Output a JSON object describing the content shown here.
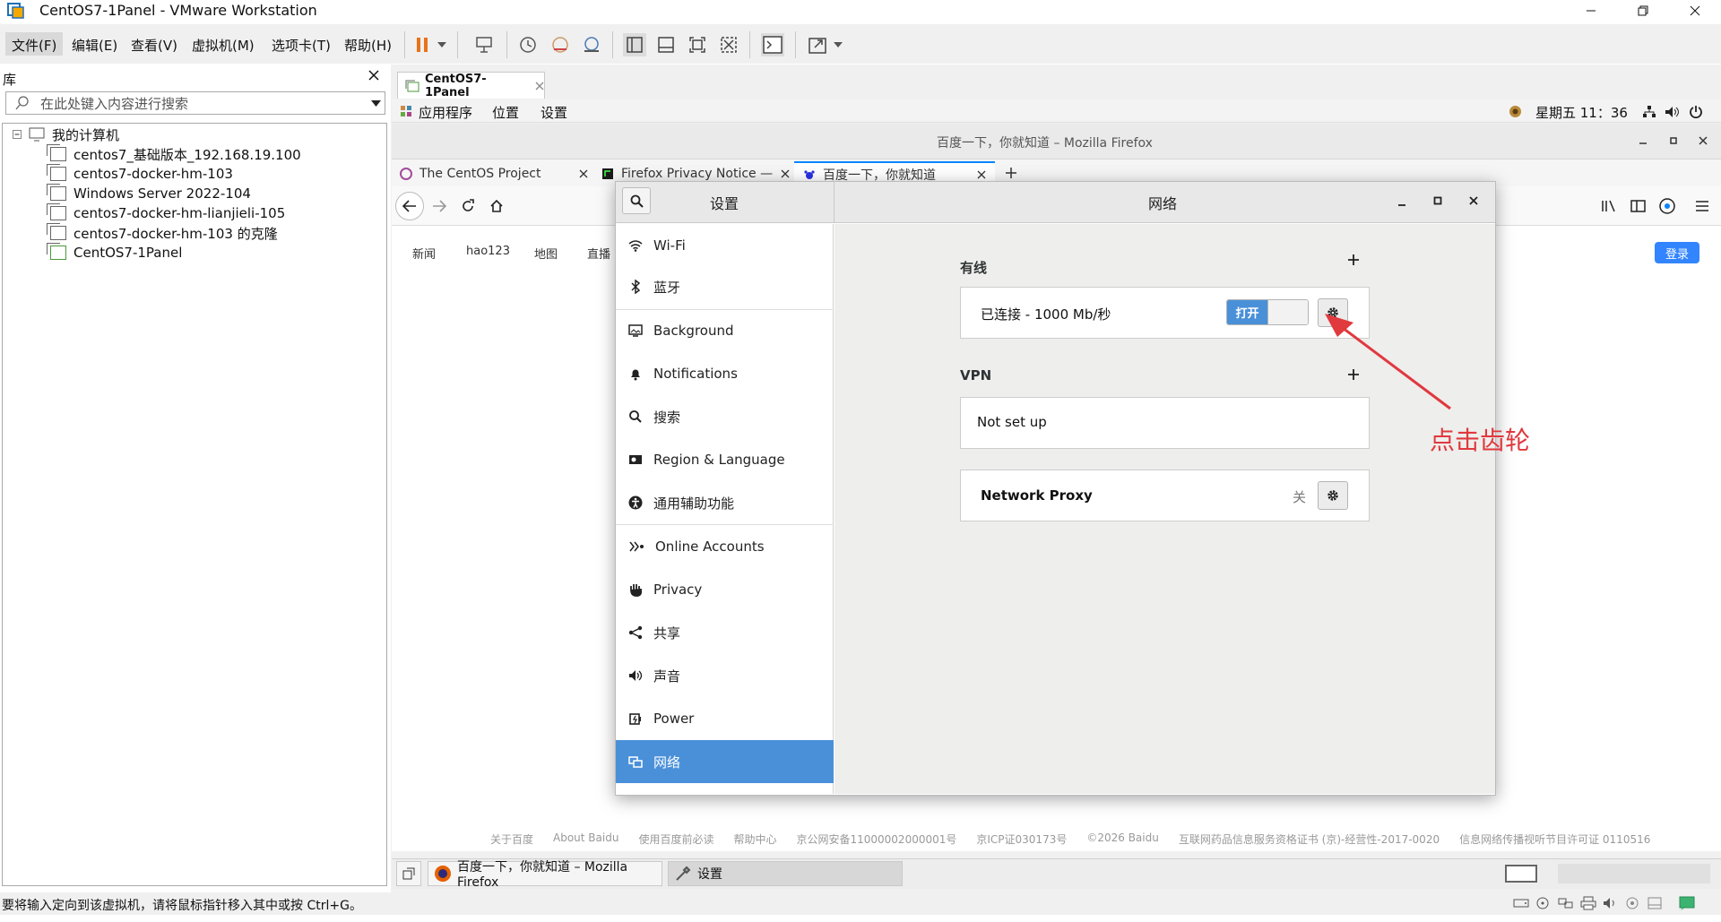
{
  "vm_window": {
    "title": "CentOS7-1Panel - VMware Workstation",
    "menus": [
      "文件(F)",
      "编辑(E)",
      "查看(V)",
      "虚拟机(M)",
      "选项卡(T)",
      "帮助(H)"
    ]
  },
  "library": {
    "title": "库",
    "search_placeholder": "在此处键入内容进行搜索",
    "root": "我的计算机",
    "items": [
      "centos7_基础版本_192.168.19.100",
      "centos7-docker-hm-103",
      "Windows Server 2022-104",
      "centos7-docker-hm-lianjieli-105",
      "centos7-docker-hm-103 的克隆",
      "CentOS7-1Panel"
    ]
  },
  "vm_tab": {
    "label": "CentOS7-1Panel"
  },
  "gnome_top": {
    "menus": [
      "应用程序",
      "位置",
      "设置"
    ],
    "clock": "星期五 11：36"
  },
  "firefox": {
    "window_title": "百度一下，你就知道 – Mozilla Firefox",
    "tabs": [
      "The CentOS Project",
      "Firefox Privacy Notice —",
      "百度一下，你就知道"
    ],
    "baidu_links": [
      "新闻",
      "hao123",
      "地图",
      "直播"
    ],
    "login": "登录",
    "footer": [
      "关于百度",
      "About Baidu",
      "使用百度前必读",
      "帮助中心",
      "京公网安备11000002000001号",
      "京ICP证030173号",
      "©2026 Baidu",
      "互联网药品信息服务资格证书 (京)-经营性-2017-0020",
      "信息网络传播视听节目许可证 0110516"
    ]
  },
  "taskbar": {
    "items": [
      "百度一下，你就知道 – Mozilla Firefox",
      "设置"
    ]
  },
  "status_bar": "要将输入定向到该虚拟机，请将鼠标指针移入其中或按 Ctrl+G。",
  "settings": {
    "left_title": "设置",
    "right_title": "网络",
    "sidebar": [
      {
        "label": "Wi-Fi",
        "icon": "wifi-icon"
      },
      {
        "label": "蓝牙",
        "icon": "bluetooth-icon"
      },
      {
        "label": "Background",
        "icon": "background-icon"
      },
      {
        "label": "Notifications",
        "icon": "bell-icon"
      },
      {
        "label": "搜索",
        "icon": "search-icon"
      },
      {
        "label": "Region & Language",
        "icon": "region-icon"
      },
      {
        "label": "通用辅助功能",
        "icon": "accessibility-icon"
      },
      {
        "label": "Online Accounts",
        "icon": "online-accounts-icon"
      },
      {
        "label": "Privacy",
        "icon": "hand-icon"
      },
      {
        "label": "共享",
        "icon": "share-icon"
      },
      {
        "label": "声音",
        "icon": "speaker-icon"
      },
      {
        "label": "Power",
        "icon": "power-icon"
      },
      {
        "label": "网络",
        "icon": "network-icon"
      }
    ],
    "wired": {
      "title": "有线",
      "status": "已连接 - 1000 Mb/秒",
      "toggle_on": "打开"
    },
    "vpn": {
      "title": "VPN",
      "status": "Not set up"
    },
    "proxy": {
      "label": "Network Proxy",
      "value": "关"
    }
  },
  "annotation": "点击齿轮"
}
